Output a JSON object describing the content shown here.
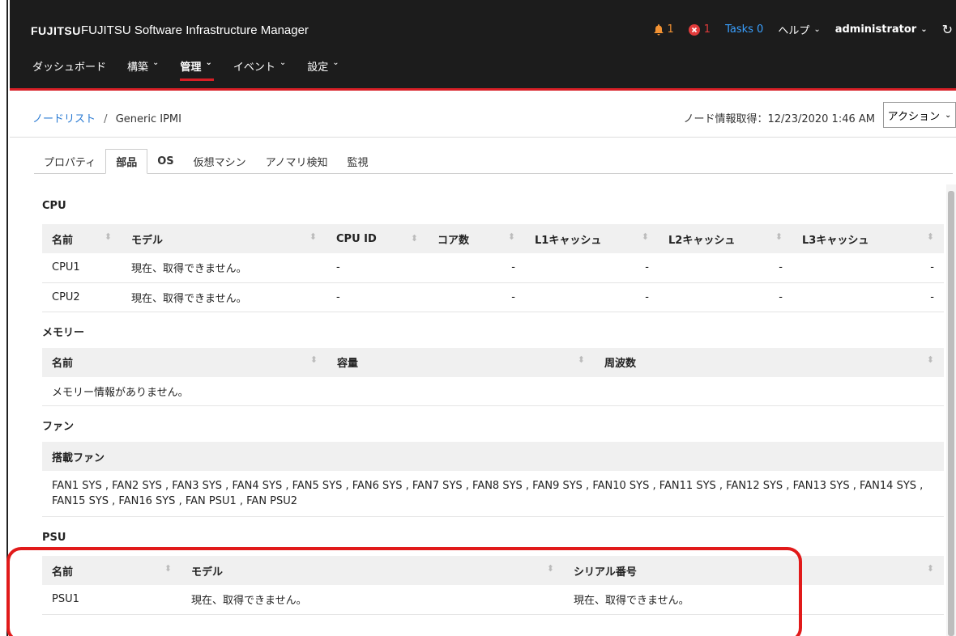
{
  "header": {
    "logo": "FUJITSU",
    "app_title": "FUJITSU Software Infrastructure Manager",
    "alerts_warning_count": "1",
    "alerts_error_count": "1",
    "tasks_label": "Tasks 0",
    "help_label": "ヘルプ",
    "user_label": "administrator"
  },
  "nav": {
    "items": [
      {
        "label": "ダッシュボード"
      },
      {
        "label": "構築"
      },
      {
        "label": "管理"
      },
      {
        "label": "イベント"
      },
      {
        "label": "設定"
      }
    ]
  },
  "breadcrumb": {
    "parent": "ノードリスト",
    "separator": "/",
    "current": "Generic IPMI"
  },
  "node_info": {
    "updated": "ノード情報取得：12/23/2020 1:46 AM",
    "action_label": "アクション"
  },
  "tabs": [
    "プロパティ",
    "部品",
    "OS",
    "仮想マシン",
    "アノマリ検知",
    "監視"
  ],
  "cpu": {
    "title": "CPU",
    "headers": [
      "名前",
      "モデル",
      "CPU ID",
      "コア数",
      "L1キャッシュ",
      "L2キャッシュ",
      "L3キャッシュ"
    ],
    "rows": [
      [
        "CPU1",
        "現在、取得できません。",
        "-",
        "-",
        "-",
        "-",
        "-"
      ],
      [
        "CPU2",
        "現在、取得できません。",
        "-",
        "-",
        "-",
        "-",
        "-"
      ]
    ]
  },
  "memory": {
    "title": "メモリー",
    "headers": [
      "名前",
      "容量",
      "周波数"
    ],
    "empty": "メモリー情報がありません。"
  },
  "fan": {
    "title": "ファン",
    "header": "搭載ファン",
    "value": "FAN1 SYS , FAN2 SYS , FAN3 SYS , FAN4 SYS , FAN5 SYS , FAN6 SYS , FAN7 SYS , FAN8 SYS , FAN9 SYS , FAN10 SYS , FAN11 SYS , FAN12 SYS , FAN13 SYS , FAN14 SYS , FAN15 SYS , FAN16 SYS , FAN PSU1 , FAN PSU2"
  },
  "psu": {
    "title": "PSU",
    "headers": [
      "名前",
      "モデル",
      "シリアル番号"
    ],
    "rows": [
      [
        "PSU1",
        "現在、取得できません。",
        "現在、取得できません。"
      ]
    ]
  },
  "colors": {
    "header_bg": "#1c1c1c",
    "accent_red": "#d81f26",
    "link_blue": "#2b7bd3",
    "tasks_blue": "#3aa0ff",
    "warning_orange": "#f29233"
  }
}
